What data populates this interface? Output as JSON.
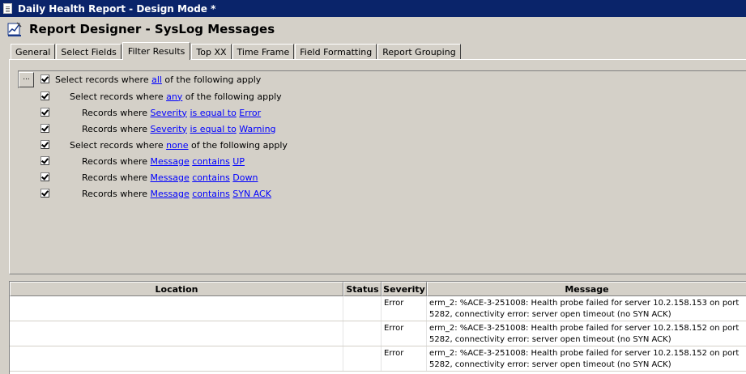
{
  "window": {
    "title": "Daily Health Report - Design Mode *"
  },
  "header": {
    "title": "Report Designer - SysLog Messages"
  },
  "tabs": [
    "General",
    "Select Fields",
    "Filter Results",
    "Top XX",
    "Time Frame",
    "Field Formatting",
    "Report Grouping"
  ],
  "active_tab": "Filter Results",
  "filter": {
    "more_button": "...",
    "root": {
      "prefix": "Select records where ",
      "quantifier": "all",
      "suffix": " of the following apply"
    },
    "groups": [
      {
        "prefix": "Select records where ",
        "quantifier": "any",
        "suffix": " of the following apply",
        "conditions": [
          {
            "prefix": "Records where ",
            "field": "Severity",
            "operator": "is equal to",
            "value": "Error"
          },
          {
            "prefix": "Records where ",
            "field": "Severity",
            "operator": "is equal to",
            "value": "Warning"
          }
        ]
      },
      {
        "prefix": "Select records where ",
        "quantifier": "none",
        "suffix": " of the following apply",
        "conditions": [
          {
            "prefix": "Records where ",
            "field": "Message",
            "operator": "contains",
            "value": "UP"
          },
          {
            "prefix": "Records where ",
            "field": "Message",
            "operator": "contains",
            "value": "Down"
          },
          {
            "prefix": "Records where ",
            "field": "Message",
            "operator": "contains",
            "value": "SYN ACK"
          }
        ]
      }
    ]
  },
  "table": {
    "columns": [
      "Location",
      "Status",
      "Severity",
      "Message"
    ],
    "rows": [
      {
        "location": "",
        "status": "",
        "severity": "Error",
        "message": "erm_2: %ACE-3-251008: Health probe failed for server 10.2.158.153 on port 5282, connectivity error: server open timeout (no SYN ACK)"
      },
      {
        "location": "",
        "status": "",
        "severity": "Error",
        "message": "erm_2: %ACE-3-251008: Health probe failed for server 10.2.158.152 on port 5282, connectivity error: server open timeout (no SYN ACK)"
      },
      {
        "location": "",
        "status": "",
        "severity": "Error",
        "message": "erm_2: %ACE-3-251008: Health probe failed for server 10.2.158.152 on port 5282, connectivity error: server open timeout (no SYN ACK)"
      }
    ]
  },
  "colors": {
    "titlebar": "#0a246a",
    "link": "#0000ff",
    "face": "#d4d0c8"
  },
  "icons": {
    "window": "document-icon",
    "header": "report-designer-icon"
  }
}
